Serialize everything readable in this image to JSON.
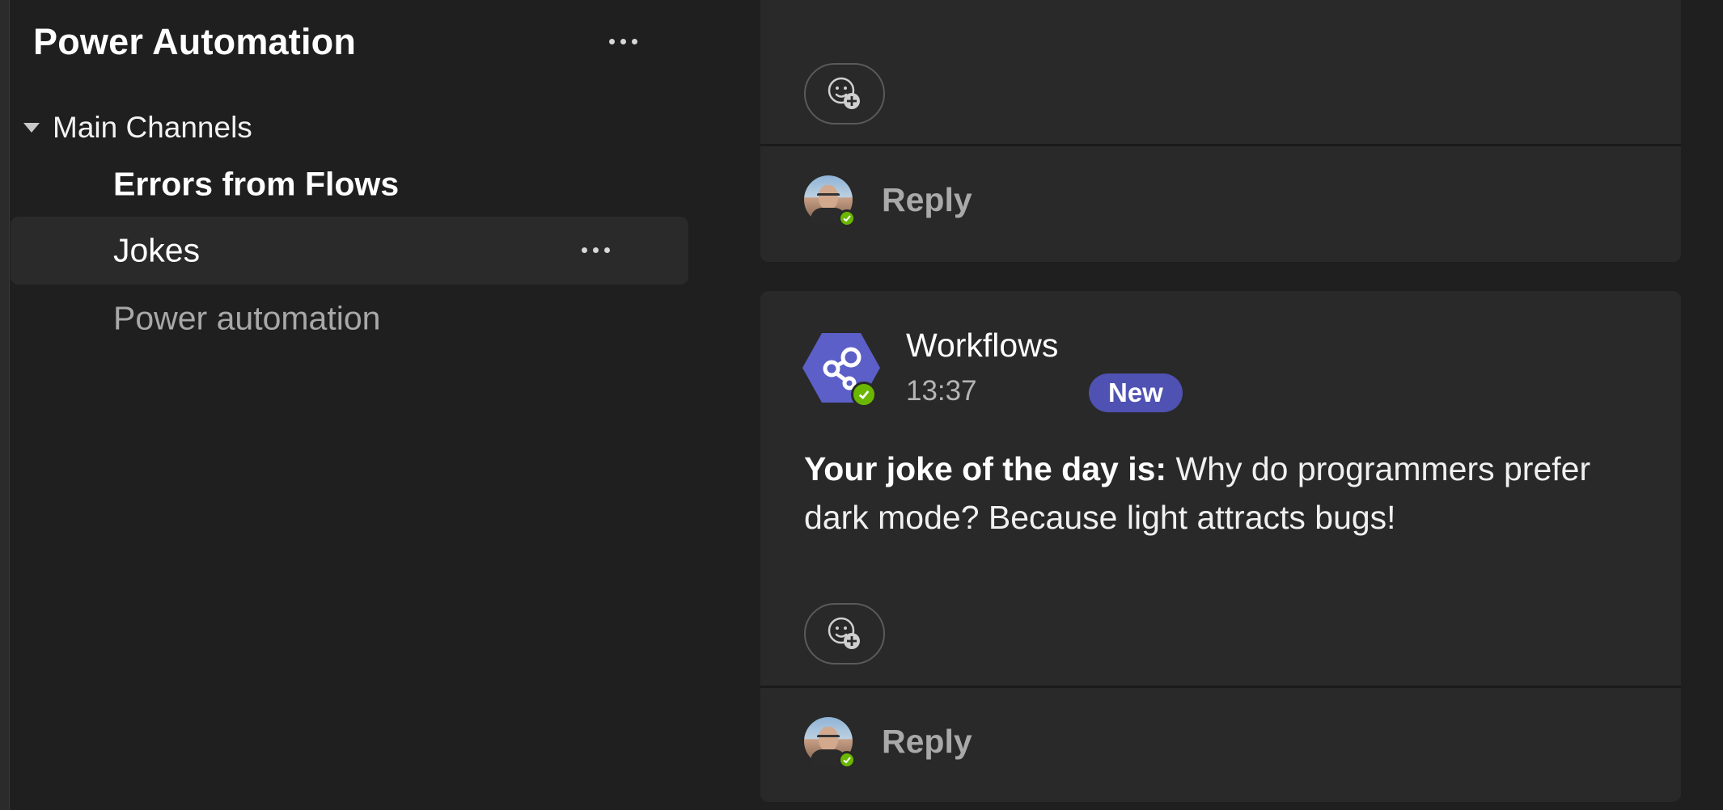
{
  "sidebar": {
    "team_title": "Power Automation",
    "group": {
      "label": "Main Channels"
    },
    "channels": [
      {
        "label": "Errors from Flows",
        "unread": true
      },
      {
        "label": "Jokes",
        "selected": true
      },
      {
        "label": "Power automation",
        "muted": true
      }
    ]
  },
  "thread": {
    "top_card": {
      "reaction_icon": "add-reaction-icon",
      "reply_label": "Reply"
    },
    "message": {
      "sender": "Workflows",
      "time": "13:37",
      "badge": "New",
      "body_bold": "Your joke of the day is:",
      "body_text": "Why do programmers prefer dark mode? Because light attracts bugs!",
      "reaction_icon": "add-reaction-icon",
      "reply_label": "Reply"
    }
  },
  "colors": {
    "background": "#1f1f1f",
    "card": "#292929",
    "accent_badge": "#4f52b2",
    "bot_avatar": "#5b5fc7",
    "presence": "#6bb700"
  }
}
